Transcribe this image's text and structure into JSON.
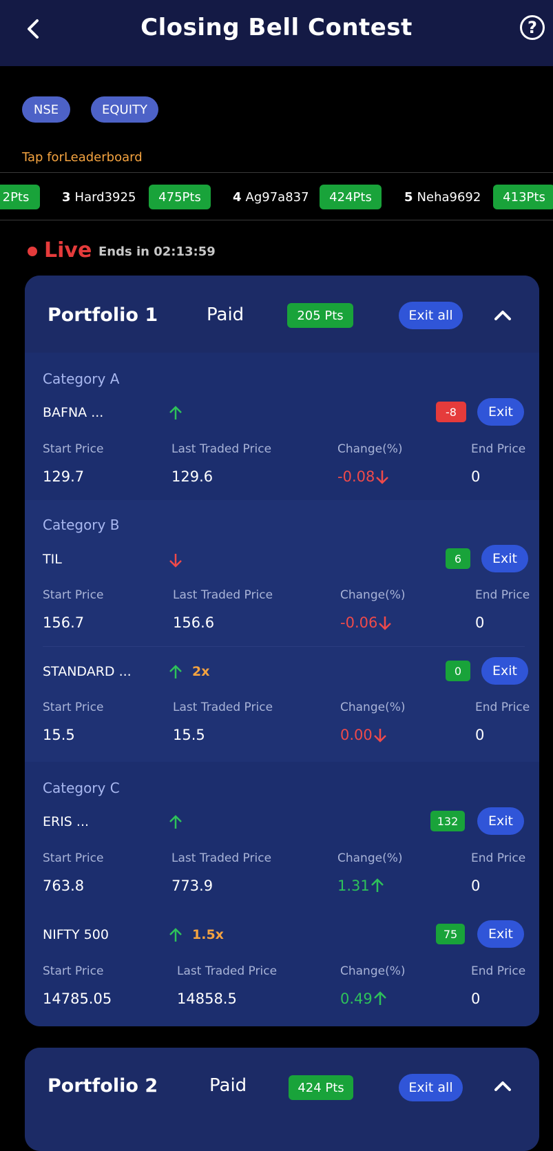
{
  "header": {
    "title": "Closing Bell Contest"
  },
  "chips": [
    "NSE",
    "EQUITY"
  ],
  "leaderboard_link": "Tap forLeaderboard",
  "ticker": [
    {
      "rank": "",
      "name": "",
      "pts": "2Pts"
    },
    {
      "rank": "3",
      "name": "Hard3925",
      "pts": "475Pts"
    },
    {
      "rank": "4",
      "name": "Ag97a837",
      "pts": "424Pts"
    },
    {
      "rank": "5",
      "name": "Neha9692",
      "pts": "413Pts"
    }
  ],
  "live": {
    "label": "Live",
    "ends_in": "Ends in 02:13:59"
  },
  "labels": {
    "start_price": "Start Price",
    "ltp": "Last Traded Price",
    "change": "Change(%)",
    "end_price": "End Price",
    "exit": "Exit",
    "exit_all": "Exit all",
    "paid": "Paid"
  },
  "portfolios": [
    {
      "name": "Portfolio 1",
      "pts": "205 Pts",
      "categories": [
        {
          "name": "Category A",
          "stocks": [
            {
              "name": "BAFNA ...",
              "trend": "up",
              "multiplier": "",
              "points": "-8",
              "start": "129.7",
              "ltp": "129.6",
              "change": "-0.08",
              "change_dir": "down",
              "end": "0"
            }
          ]
        },
        {
          "name": "Category B",
          "stocks": [
            {
              "name": "TIL",
              "trend": "down",
              "multiplier": "",
              "points": "6",
              "start": "156.7",
              "ltp": "156.6",
              "change": "-0.06",
              "change_dir": "down",
              "end": "0"
            },
            {
              "name": "STANDARD ...",
              "trend": "up",
              "multiplier": "2x",
              "points": "0",
              "start": "15.5",
              "ltp": "15.5",
              "change": "0.00",
              "change_dir": "down",
              "end": "0"
            }
          ]
        },
        {
          "name": "Category C",
          "stocks": [
            {
              "name": "ERIS ...",
              "trend": "up",
              "multiplier": "",
              "points": "132",
              "start": "763.8",
              "ltp": "773.9",
              "change": "1.31",
              "change_dir": "up",
              "end": "0"
            },
            {
              "name": "NIFTY 500",
              "trend": "up",
              "multiplier": "1.5x",
              "points": "75",
              "start": "14785.05",
              "ltp": "14858.5",
              "change": "0.49",
              "change_dir": "up",
              "end": "0"
            }
          ]
        }
      ]
    },
    {
      "name": "Portfolio 2",
      "pts": "424 Pts"
    }
  ],
  "colors": {
    "header_bg": "#141a45",
    "card_bg": "#1c2b66",
    "green": "#19a33a",
    "red": "#e53b3b",
    "accent": "#3055d8",
    "orange": "#f4a340"
  },
  "icons": {
    "back": "chevron-left-icon",
    "help": "help-circle-icon",
    "collapse": "chevron-up-icon",
    "up": "arrow-up-icon",
    "down": "arrow-down-icon"
  }
}
